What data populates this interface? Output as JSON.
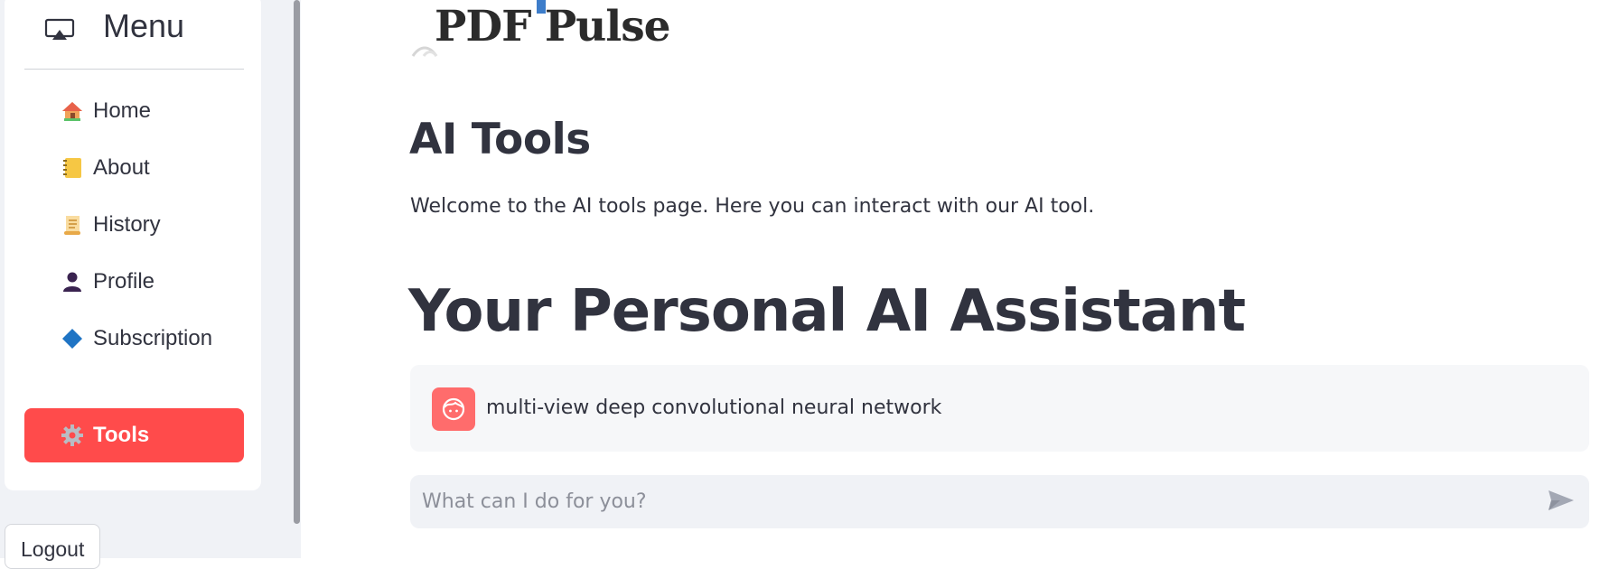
{
  "sidebar": {
    "menu_title": "Menu",
    "menu_icon": "cast-icon",
    "items": [
      {
        "label": "Home",
        "icon": "house-icon"
      },
      {
        "label": "About",
        "icon": "notebook-icon"
      },
      {
        "label": "History",
        "icon": "scroll-icon"
      },
      {
        "label": "Profile",
        "icon": "person-icon"
      },
      {
        "label": "Subscription",
        "icon": "diamond-icon"
      },
      {
        "label": "Tools",
        "icon": "gear-icon",
        "active": true
      }
    ],
    "logout_label": "Logout"
  },
  "logo": {
    "text": "PDF Pulse"
  },
  "main": {
    "title": "AI Tools",
    "description": "Welcome to the AI tools page. Here you can interact with our AI tool.",
    "assistant_title": "Your Personal AI Assistant",
    "chat": {
      "messages": [
        {
          "role": "user",
          "avatar_icon": "face-icon",
          "text": "multi-view deep convolutional neural network"
        }
      ],
      "input_placeholder": "What can I do for you?",
      "input_value": "",
      "send_icon": "send-icon"
    }
  },
  "colors": {
    "accent": "#ff4b4b",
    "avatar": "#ff6c6c",
    "sidebar_bg": "#f0f2f6",
    "text": "#31333f"
  }
}
